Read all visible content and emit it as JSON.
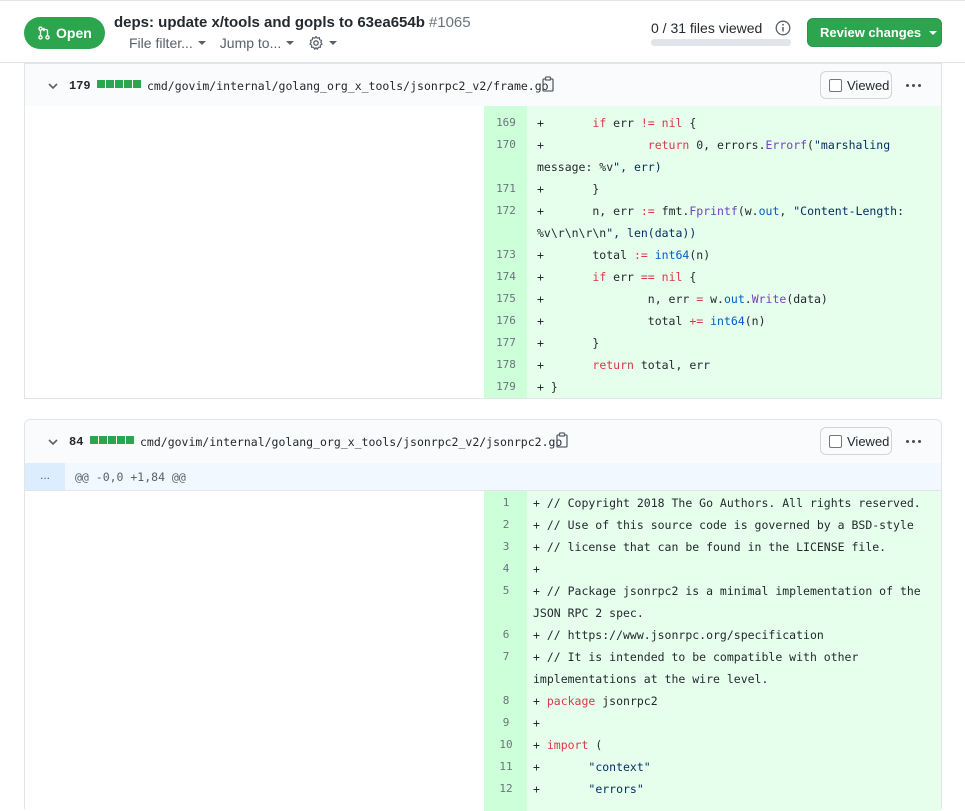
{
  "header": {
    "status_label": "Open",
    "title": "deps: update x/tools and gopls to 63ea654b",
    "number": "#1065",
    "file_filter_label": "File filter...",
    "jump_to_label": "Jump to...",
    "files_viewed": "0 / 31 files viewed",
    "files_viewed_progress": 0,
    "review_button_label": "Review changes",
    "accent_color": "#2da44e"
  },
  "files": [
    {
      "additions": "179",
      "path": "cmd/govim/internal/golang_org_x_tools/jsonrpc2_v2/frame.go",
      "viewed_label": "Viewed",
      "lines": [
        {
          "n": "169",
          "t": "+       if err != nil {"
        },
        {
          "n": "170",
          "t": "+               return 0, errors.Errorf(\"marshaling"
        },
        {
          "n": "",
          "t": "message: %v\", err)"
        },
        {
          "n": "171",
          "t": "+       }"
        },
        {
          "n": "172",
          "t": "+       n, err := fmt.Fprintf(w.out, \"Content-Length:"
        },
        {
          "n": "",
          "t": "%v\\r\\n\\r\\n\", len(data))"
        },
        {
          "n": "173",
          "t": "+       total := int64(n)"
        },
        {
          "n": "174",
          "t": "+       if err == nil {"
        },
        {
          "n": "175",
          "t": "+               n, err = w.out.Write(data)"
        },
        {
          "n": "176",
          "t": "+               total += int64(n)"
        },
        {
          "n": "177",
          "t": "+       }"
        },
        {
          "n": "178",
          "t": "+       return total, err"
        },
        {
          "n": "179",
          "t": "+ }"
        }
      ]
    },
    {
      "additions": "84",
      "path": "cmd/govim/internal/golang_org_x_tools/jsonrpc2_v2/jsonrpc2.go",
      "viewed_label": "Viewed",
      "hunk_expand": "...",
      "hunk_header": "@@ -0,0 +1,84 @@",
      "lines": [
        {
          "n": "1",
          "t": "+ // Copyright 2018 The Go Authors. All rights reserved."
        },
        {
          "n": "2",
          "t": "+ // Use of this source code is governed by a BSD-style"
        },
        {
          "n": "3",
          "t": "+ // license that can be found in the LICENSE file."
        },
        {
          "n": "4",
          "t": "+"
        },
        {
          "n": "5",
          "t": "+ // Package jsonrpc2 is a minimal implementation of the"
        },
        {
          "n": "",
          "t": "JSON RPC 2 spec."
        },
        {
          "n": "6",
          "t": "+ // https://www.jsonrpc.org/specification"
        },
        {
          "n": "7",
          "t": "+ // It is intended to be compatible with other"
        },
        {
          "n": "",
          "t": "implementations at the wire level."
        },
        {
          "n": "8",
          "t": "+ package jsonrpc2"
        },
        {
          "n": "9",
          "t": "+"
        },
        {
          "n": "10",
          "t": "+ import ("
        },
        {
          "n": "11",
          "t": "+       \"context\""
        },
        {
          "n": "12",
          "t": "+       \"errors\""
        }
      ]
    }
  ]
}
